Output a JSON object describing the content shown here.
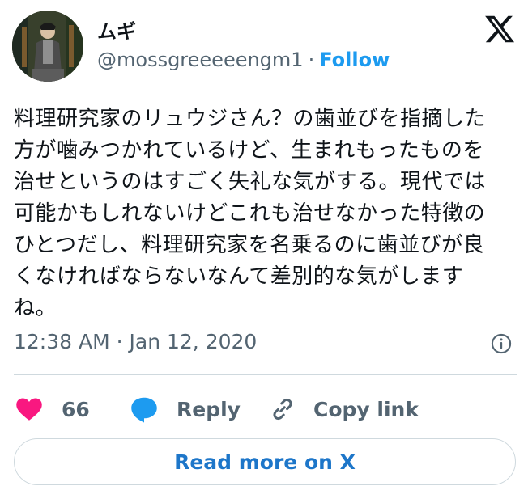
{
  "author": {
    "display_name": "ムギ",
    "handle": "@mossgreeeeengm1",
    "separator": "·",
    "follow_label": "Follow"
  },
  "tweet": {
    "text": "料理研究家のリュウジさん？の歯並びを指摘した\n方が噛みつかれているけど、生まれもったものを\n治せというのはすごく失礼な気がする。現代では\n可能かもしれないけどこれも治せなかった特徴の\nひとつだし、料理研究家を名乗るのに歯並びが良\nくなければならないなんて差別的な気がします\nね。",
    "timestamp": "12:38 AM · Jan 12, 2020"
  },
  "actions": {
    "like_count": "66",
    "reply_label": "Reply",
    "copy_link_label": "Copy link"
  },
  "read_more_label": "Read more on X",
  "icons": {
    "logo": "x-logo-icon",
    "info": "info-icon",
    "like": "heart-icon",
    "reply": "speech-bubble-icon",
    "copy": "link-icon"
  },
  "colors": {
    "accent": "#1d9bf0",
    "heart": "#f91880",
    "reply_bubble": "#1d9bf0",
    "muted_text": "#536471",
    "border": "#cfd9de"
  }
}
